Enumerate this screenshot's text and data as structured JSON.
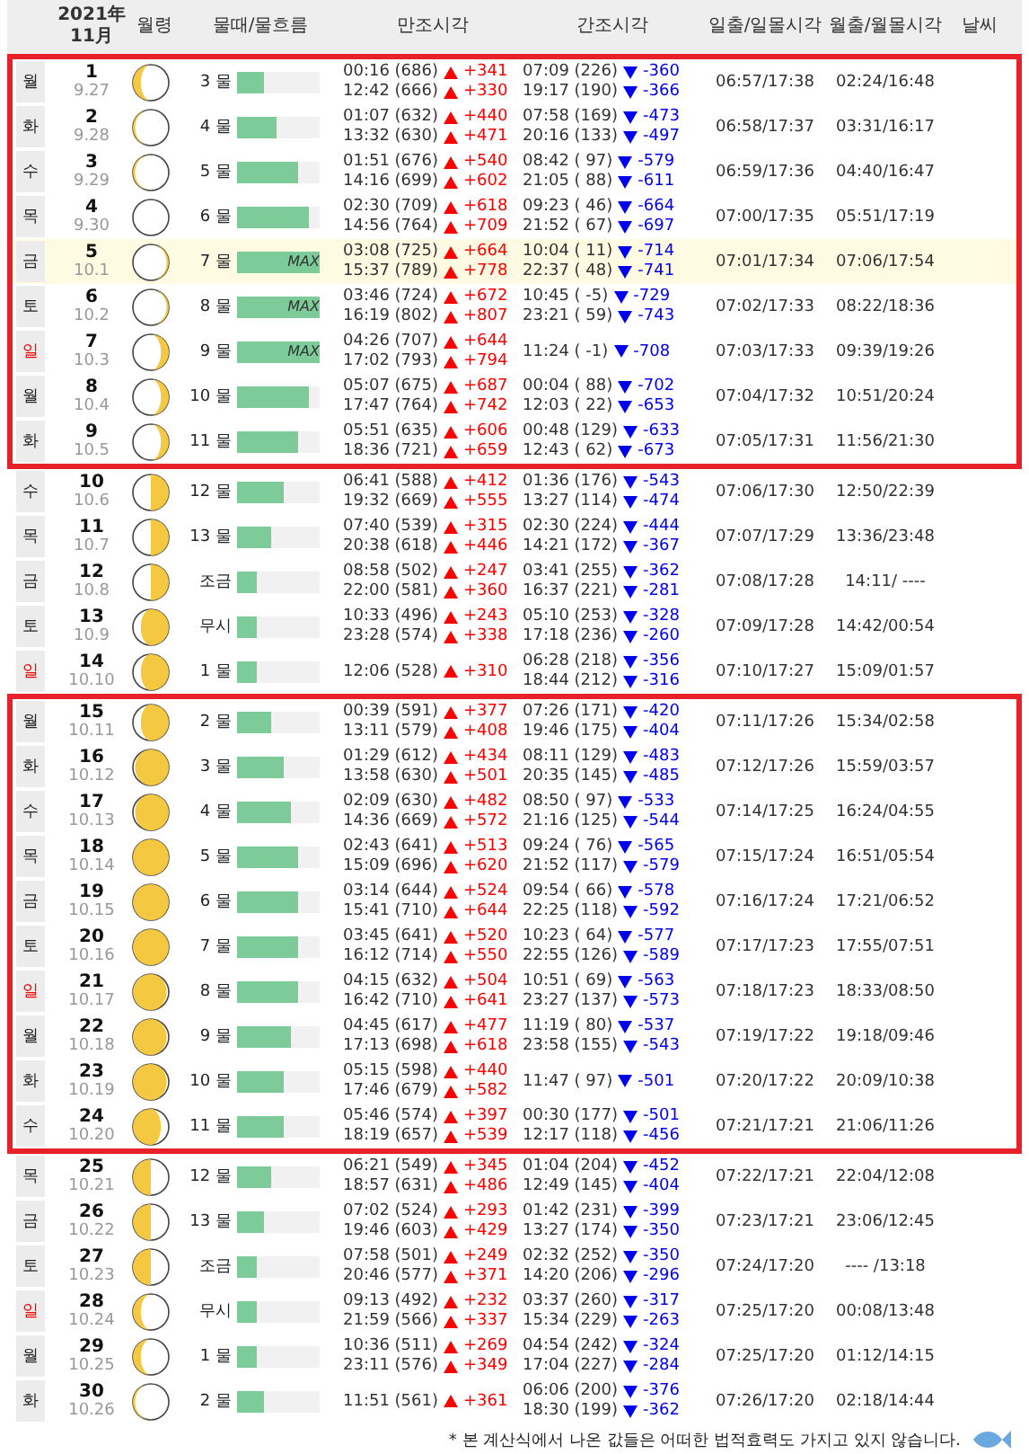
{
  "header": {
    "year": "2021年",
    "month": "11月",
    "columns": [
      "월령",
      "물때/물흐름",
      "만조시각",
      "간조시각",
      "일출/일몰시각",
      "월출/월몰시각",
      "날씨"
    ]
  },
  "groups": [
    {
      "boxed": true,
      "rows": [
        {
          "weekday": "월",
          "holiday": false,
          "highlighted": false,
          "day": "1",
          "lunar": "9.27",
          "moon": {
            "kind": "waning-crescent"
          },
          "tide": "3 물",
          "bar": {
            "level": 0.33
          },
          "high": [
            {
              "time": "00:16 (686)",
              "change": "+341"
            },
            {
              "time": "12:42 (666)",
              "change": "+330"
            }
          ],
          "low": [
            {
              "time": "07:09 (226)",
              "change": "-360"
            },
            {
              "time": "19:17 (190)",
              "change": "-366"
            }
          ],
          "sun": "06:57/17:38",
          "moonrise": "02:24/16:48"
        },
        {
          "weekday": "화",
          "holiday": false,
          "highlighted": false,
          "day": "2",
          "lunar": "9.28",
          "moon": {
            "kind": "waning-sliver"
          },
          "tide": "4 물",
          "bar": {
            "level": 0.48
          },
          "high": [
            {
              "time": "01:07 (632)",
              "change": "+440"
            },
            {
              "time": "13:32 (630)",
              "change": "+471"
            }
          ],
          "low": [
            {
              "time": "07:58 (169)",
              "change": "-473"
            },
            {
              "time": "20:16 (133)",
              "change": "-497"
            }
          ],
          "sun": "06:58/17:37",
          "moonrise": "03:31/16:17"
        },
        {
          "weekday": "수",
          "holiday": false,
          "highlighted": false,
          "day": "3",
          "lunar": "9.29",
          "moon": {
            "kind": "waning-sliver"
          },
          "tide": "5 물",
          "bar": {
            "level": 0.73
          },
          "high": [
            {
              "time": "01:51 (676)",
              "change": "+540"
            },
            {
              "time": "14:16 (699)",
              "change": "+602"
            }
          ],
          "low": [
            {
              "time": "08:42 ( 97)",
              "change": "-579"
            },
            {
              "time": "21:05 ( 88)",
              "change": "-611"
            }
          ],
          "sun": "06:59/17:36",
          "moonrise": "04:40/16:47"
        },
        {
          "weekday": "목",
          "holiday": false,
          "highlighted": false,
          "day": "4",
          "lunar": "9.30",
          "moon": {
            "kind": "new"
          },
          "tide": "6 물",
          "bar": {
            "level": 0.88
          },
          "high": [
            {
              "time": "02:30 (709)",
              "change": "+618"
            },
            {
              "time": "14:56 (764)",
              "change": "+709"
            }
          ],
          "low": [
            {
              "time": "09:23 ( 46)",
              "change": "-664"
            },
            {
              "time": "21:52 ( 67)",
              "change": "-697"
            }
          ],
          "sun": "07:00/17:35",
          "moonrise": "05:51/17:19"
        },
        {
          "weekday": "금",
          "holiday": false,
          "highlighted": true,
          "day": "5",
          "lunar": "10.1",
          "moon": {
            "kind": "waxing-sliver"
          },
          "tide": "7 물",
          "bar": {
            "level": 1,
            "label": "MAX"
          },
          "high": [
            {
              "time": "03:08 (725)",
              "change": "+664"
            },
            {
              "time": "15:37 (789)",
              "change": "+778"
            }
          ],
          "low": [
            {
              "time": "10:04 ( 11)",
              "change": "-714"
            },
            {
              "time": "22:37 ( 48)",
              "change": "-741"
            }
          ],
          "sun": "07:01/17:34",
          "moonrise": "07:06/17:54"
        },
        {
          "weekday": "토",
          "holiday": false,
          "highlighted": false,
          "day": "6",
          "lunar": "10.2",
          "moon": {
            "kind": "waxing-sliver"
          },
          "tide": "8 물",
          "bar": {
            "level": 1,
            "label": "MAX"
          },
          "high": [
            {
              "time": "03:46 (724)",
              "change": "+672"
            },
            {
              "time": "16:19 (802)",
              "change": "+807"
            }
          ],
          "low": [
            {
              "time": "10:45 ( -5)",
              "change": "-729"
            },
            {
              "time": "23:21 ( 59)",
              "change": "-743"
            }
          ],
          "sun": "07:02/17:33",
          "moonrise": "08:22/18:36"
        },
        {
          "weekday": "일",
          "holiday": true,
          "highlighted": false,
          "day": "7",
          "lunar": "10.3",
          "moon": {
            "kind": "waxing-crescent"
          },
          "tide": "9 물",
          "bar": {
            "level": 1,
            "label": "MAX"
          },
          "high": [
            {
              "time": "04:26 (707)",
              "change": "+644"
            },
            {
              "time": "17:02 (793)",
              "change": "+794"
            }
          ],
          "low": [
            {
              "time": "11:24 ( -1)",
              "change": "-708"
            }
          ],
          "sun": "07:03/17:33",
          "moonrise": "09:39/19:26"
        },
        {
          "weekday": "월",
          "holiday": false,
          "highlighted": false,
          "day": "8",
          "lunar": "10.4",
          "moon": {
            "kind": "waxing-crescent"
          },
          "tide": "10 물",
          "bar": {
            "level": 0.88
          },
          "high": [
            {
              "time": "05:07 (675)",
              "change": "+687"
            },
            {
              "time": "17:47 (764)",
              "change": "+742"
            }
          ],
          "low": [
            {
              "time": "00:04 ( 88)",
              "change": "-702"
            },
            {
              "time": "12:03 ( 22)",
              "change": "-653"
            }
          ],
          "sun": "07:04/17:32",
          "moonrise": "10:51/20:24"
        },
        {
          "weekday": "화",
          "holiday": false,
          "highlighted": false,
          "day": "9",
          "lunar": "10.5",
          "moon": {
            "kind": "waxing-crescent"
          },
          "tide": "11 물",
          "bar": {
            "level": 0.73
          },
          "high": [
            {
              "time": "05:51 (635)",
              "change": "+606"
            },
            {
              "time": "18:36 (721)",
              "change": "+659"
            }
          ],
          "low": [
            {
              "time": "00:48 (129)",
              "change": "-633"
            },
            {
              "time": "12:43 ( 62)",
              "change": "-673"
            }
          ],
          "sun": "07:05/17:31",
          "moonrise": "11:56/21:30"
        }
      ]
    },
    {
      "boxed": false,
      "rows": [
        {
          "weekday": "수",
          "holiday": false,
          "highlighted": false,
          "day": "10",
          "lunar": "10.6",
          "moon": {
            "kind": "first-quarter"
          },
          "tide": "12 물",
          "bar": {
            "level": 0.57
          },
          "high": [
            {
              "time": "06:41 (588)",
              "change": "+412"
            },
            {
              "time": "19:32 (669)",
              "change": "+555"
            }
          ],
          "low": [
            {
              "time": "01:36 (176)",
              "change": "-543"
            },
            {
              "time": "13:27 (114)",
              "change": "-474"
            }
          ],
          "sun": "07:06/17:30",
          "moonrise": "12:50/22:39"
        },
        {
          "weekday": "목",
          "holiday": false,
          "highlighted": false,
          "day": "11",
          "lunar": "10.7",
          "moon": {
            "kind": "first-quarter"
          },
          "tide": "13 물",
          "bar": {
            "level": 0.42
          },
          "high": [
            {
              "time": "07:40 (539)",
              "change": "+315"
            },
            {
              "time": "20:38 (618)",
              "change": "+446"
            }
          ],
          "low": [
            {
              "time": "02:30 (224)",
              "change": "-444"
            },
            {
              "time": "14:21 (172)",
              "change": "-367"
            }
          ],
          "sun": "07:07/17:29",
          "moonrise": "13:36/23:48"
        },
        {
          "weekday": "금",
          "holiday": false,
          "highlighted": false,
          "day": "12",
          "lunar": "10.8",
          "moon": {
            "kind": "first-quarter"
          },
          "tide": "조금",
          "bar": {
            "level": 0.24
          },
          "high": [
            {
              "time": "08:58 (502)",
              "change": "+247"
            },
            {
              "time": "22:00 (581)",
              "change": "+360"
            }
          ],
          "low": [
            {
              "time": "03:41 (255)",
              "change": "-362"
            },
            {
              "time": "16:37 (221)",
              "change": "-281"
            }
          ],
          "sun": "07:08/17:28",
          "moonrise": "14:11/ ----"
        },
        {
          "weekday": "토",
          "holiday": false,
          "highlighted": false,
          "day": "13",
          "lunar": "10.9",
          "moon": {
            "kind": "waxing-gibbous"
          },
          "tide": "무시",
          "bar": {
            "level": 0.24
          },
          "high": [
            {
              "time": "10:33 (496)",
              "change": "+243"
            },
            {
              "time": "23:28 (574)",
              "change": "+338"
            }
          ],
          "low": [
            {
              "time": "05:10 (253)",
              "change": "-328"
            },
            {
              "time": "17:18 (236)",
              "change": "-260"
            }
          ],
          "sun": "07:09/17:28",
          "moonrise": "14:42/00:54"
        },
        {
          "weekday": "일",
          "holiday": true,
          "highlighted": false,
          "day": "14",
          "lunar": "10.10",
          "moon": {
            "kind": "waxing-gibbous"
          },
          "tide": "1 물",
          "bar": {
            "level": 0.24
          },
          "high": [
            {
              "time": "12:06 (528)",
              "change": "+310"
            }
          ],
          "low": [
            {
              "time": "06:28 (218)",
              "change": "-356"
            },
            {
              "time": "18:44 (212)",
              "change": "-316"
            }
          ],
          "sun": "07:10/17:27",
          "moonrise": "15:09/01:57"
        }
      ]
    },
    {
      "boxed": true,
      "rows": [
        {
          "weekday": "월",
          "holiday": false,
          "highlighted": false,
          "day": "15",
          "lunar": "10.11",
          "moon": {
            "kind": "waxing-gibbous"
          },
          "tide": "2 물",
          "bar": {
            "level": 0.42
          },
          "high": [
            {
              "time": "00:39 (591)",
              "change": "+377"
            },
            {
              "time": "13:11 (579)",
              "change": "+408"
            }
          ],
          "low": [
            {
              "time": "07:26 (171)",
              "change": "-420"
            },
            {
              "time": "19:46 (175)",
              "change": "-404"
            }
          ],
          "sun": "07:11/17:26",
          "moonrise": "15:34/02:58"
        },
        {
          "weekday": "화",
          "holiday": false,
          "highlighted": false,
          "day": "16",
          "lunar": "10.12",
          "moon": {
            "kind": "waxing-near-full"
          },
          "tide": "3 물",
          "bar": {
            "level": 0.57
          },
          "high": [
            {
              "time": "01:29 (612)",
              "change": "+434"
            },
            {
              "time": "13:58 (630)",
              "change": "+501"
            }
          ],
          "low": [
            {
              "time": "08:11 (129)",
              "change": "-483"
            },
            {
              "time": "20:35 (145)",
              "change": "-485"
            }
          ],
          "sun": "07:12/17:26",
          "moonrise": "15:59/03:57"
        },
        {
          "weekday": "수",
          "holiday": false,
          "highlighted": false,
          "day": "17",
          "lunar": "10.13",
          "moon": {
            "kind": "waxing-near-full"
          },
          "tide": "4 물",
          "bar": {
            "level": 0.66
          },
          "high": [
            {
              "time": "02:09 (630)",
              "change": "+482"
            },
            {
              "time": "14:36 (669)",
              "change": "+572"
            }
          ],
          "low": [
            {
              "time": "08:50 ( 97)",
              "change": "-533"
            },
            {
              "time": "21:16 (125)",
              "change": "-544"
            }
          ],
          "sun": "07:14/17:25",
          "moonrise": "16:24/04:55"
        },
        {
          "weekday": "목",
          "holiday": false,
          "highlighted": false,
          "day": "18",
          "lunar": "10.14",
          "moon": {
            "kind": "full"
          },
          "tide": "5 물",
          "bar": {
            "level": 0.73
          },
          "high": [
            {
              "time": "02:43 (641)",
              "change": "+513"
            },
            {
              "time": "15:09 (696)",
              "change": "+620"
            }
          ],
          "low": [
            {
              "time": "09:24 ( 76)",
              "change": "-565"
            },
            {
              "time": "21:52 (117)",
              "change": "-579"
            }
          ],
          "sun": "07:15/17:24",
          "moonrise": "16:51/05:54"
        },
        {
          "weekday": "금",
          "holiday": false,
          "highlighted": false,
          "day": "19",
          "lunar": "10.15",
          "moon": {
            "kind": "full"
          },
          "tide": "6 물",
          "bar": {
            "level": 0.73
          },
          "high": [
            {
              "time": "03:14 (644)",
              "change": "+524"
            },
            {
              "time": "15:41 (710)",
              "change": "+644"
            }
          ],
          "low": [
            {
              "time": "09:54 ( 66)",
              "change": "-578"
            },
            {
              "time": "22:25 (118)",
              "change": "-592"
            }
          ],
          "sun": "07:16/17:24",
          "moonrise": "17:21/06:52"
        },
        {
          "weekday": "토",
          "holiday": false,
          "highlighted": false,
          "day": "20",
          "lunar": "10.16",
          "moon": {
            "kind": "full"
          },
          "tide": "7 물",
          "bar": {
            "level": 0.73
          },
          "high": [
            {
              "time": "03:45 (641)",
              "change": "+520"
            },
            {
              "time": "16:12 (714)",
              "change": "+550"
            }
          ],
          "low": [
            {
              "time": "10:23 ( 64)",
              "change": "-577"
            },
            {
              "time": "22:55 (126)",
              "change": "-589"
            }
          ],
          "sun": "07:17/17:23",
          "moonrise": "17:55/07:51"
        },
        {
          "weekday": "일",
          "holiday": true,
          "highlighted": false,
          "day": "21",
          "lunar": "10.17",
          "moon": {
            "kind": "waning-near-full"
          },
          "tide": "8 물",
          "bar": {
            "level": 0.73
          },
          "high": [
            {
              "time": "04:15 (632)",
              "change": "+504"
            },
            {
              "time": "16:42 (710)",
              "change": "+641"
            }
          ],
          "low": [
            {
              "time": "10:51 ( 69)",
              "change": "-563"
            },
            {
              "time": "23:27 (137)",
              "change": "-573"
            }
          ],
          "sun": "07:18/17:23",
          "moonrise": "18:33/08:50"
        },
        {
          "weekday": "월",
          "holiday": false,
          "highlighted": false,
          "day": "22",
          "lunar": "10.18",
          "moon": {
            "kind": "waning-near-full"
          },
          "tide": "9 물",
          "bar": {
            "level": 0.66
          },
          "high": [
            {
              "time": "04:45 (617)",
              "change": "+477"
            },
            {
              "time": "17:13 (698)",
              "change": "+618"
            }
          ],
          "low": [
            {
              "time": "11:19 ( 80)",
              "change": "-537"
            },
            {
              "time": "23:58 (155)",
              "change": "-543"
            }
          ],
          "sun": "07:19/17:22",
          "moonrise": "19:18/09:46"
        },
        {
          "weekday": "화",
          "holiday": false,
          "highlighted": false,
          "day": "23",
          "lunar": "10.19",
          "moon": {
            "kind": "waning-near-full"
          },
          "tide": "10 물",
          "bar": {
            "level": 0.57
          },
          "high": [
            {
              "time": "05:15 (598)",
              "change": "+440"
            },
            {
              "time": "17:46 (679)",
              "change": "+582"
            }
          ],
          "low": [
            {
              "time": "11:47 ( 97)",
              "change": "-501"
            }
          ],
          "sun": "07:20/17:22",
          "moonrise": "20:09/10:38"
        },
        {
          "weekday": "수",
          "holiday": false,
          "highlighted": false,
          "day": "24",
          "lunar": "10.20",
          "moon": {
            "kind": "waning-gibbous"
          },
          "tide": "11 물",
          "bar": {
            "level": 0.57
          },
          "high": [
            {
              "time": "05:46 (574)",
              "change": "+397"
            },
            {
              "time": "18:19 (657)",
              "change": "+539"
            }
          ],
          "low": [
            {
              "time": "00:30 (177)",
              "change": "-501"
            },
            {
              "time": "12:17 (118)",
              "change": "-456"
            }
          ],
          "sun": "07:21/17:21",
          "moonrise": "21:06/11:26"
        }
      ]
    },
    {
      "boxed": false,
      "rows": [
        {
          "weekday": "목",
          "holiday": false,
          "highlighted": false,
          "day": "25",
          "lunar": "10.21",
          "moon": {
            "kind": "last-quarter"
          },
          "tide": "12 물",
          "bar": {
            "level": 0.42
          },
          "high": [
            {
              "time": "06:21 (549)",
              "change": "+345"
            },
            {
              "time": "18:57 (631)",
              "change": "+486"
            }
          ],
          "low": [
            {
              "time": "01:04 (204)",
              "change": "-452"
            },
            {
              "time": "12:49 (145)",
              "change": "-404"
            }
          ],
          "sun": "07:22/17:21",
          "moonrise": "22:04/12:08"
        },
        {
          "weekday": "금",
          "holiday": false,
          "highlighted": false,
          "day": "26",
          "lunar": "10.22",
          "moon": {
            "kind": "last-quarter"
          },
          "tide": "13 물",
          "bar": {
            "level": 0.33
          },
          "high": [
            {
              "time": "07:02 (524)",
              "change": "+293"
            },
            {
              "time": "19:46 (603)",
              "change": "+429"
            }
          ],
          "low": [
            {
              "time": "01:42 (231)",
              "change": "-399"
            },
            {
              "time": "13:27 (174)",
              "change": "-350"
            }
          ],
          "sun": "07:23/17:21",
          "moonrise": "23:06/12:45"
        },
        {
          "weekday": "토",
          "holiday": false,
          "highlighted": false,
          "day": "27",
          "lunar": "10.23",
          "moon": {
            "kind": "last-quarter"
          },
          "tide": "조금",
          "bar": {
            "level": 0.24
          },
          "high": [
            {
              "time": "07:58 (501)",
              "change": "+249"
            },
            {
              "time": "20:46 (577)",
              "change": "+371"
            }
          ],
          "low": [
            {
              "time": "02:32 (252)",
              "change": "-350"
            },
            {
              "time": "14:20 (206)",
              "change": "-296"
            }
          ],
          "sun": "07:24/17:20",
          "moonrise": "---- /13:18"
        },
        {
          "weekday": "일",
          "holiday": true,
          "highlighted": false,
          "day": "28",
          "lunar": "10.24",
          "moon": {
            "kind": "waning-crescent"
          },
          "tide": "무시",
          "bar": {
            "level": 0.24
          },
          "high": [
            {
              "time": "09:13 (492)",
              "change": "+232"
            },
            {
              "time": "21:59 (566)",
              "change": "+337"
            }
          ],
          "low": [
            {
              "time": "03:37 (260)",
              "change": "-317"
            },
            {
              "time": "15:34 (229)",
              "change": "-263"
            }
          ],
          "sun": "07:25/17:20",
          "moonrise": "00:08/13:48"
        },
        {
          "weekday": "월",
          "holiday": false,
          "highlighted": false,
          "day": "29",
          "lunar": "10.25",
          "moon": {
            "kind": "waning-crescent"
          },
          "tide": "1 물",
          "bar": {
            "level": 0.24
          },
          "high": [
            {
              "time": "10:36 (511)",
              "change": "+269"
            },
            {
              "time": "23:11 (576)",
              "change": "+349"
            }
          ],
          "low": [
            {
              "time": "04:54 (242)",
              "change": "-324"
            },
            {
              "time": "17:04 (227)",
              "change": "-284"
            }
          ],
          "sun": "07:25/17:20",
          "moonrise": "01:12/14:15"
        },
        {
          "weekday": "화",
          "holiday": false,
          "highlighted": false,
          "day": "30",
          "lunar": "10.26",
          "moon": {
            "kind": "waning-sliver"
          },
          "tide": "2 물",
          "bar": {
            "level": 0.33
          },
          "high": [
            {
              "time": "11:51 (561)",
              "change": "+361"
            }
          ],
          "low": [
            {
              "time": "06:06 (200)",
              "change": "-376"
            },
            {
              "time": "18:30 (199)",
              "change": "-362"
            }
          ],
          "sun": "07:26/17:20",
          "moonrise": "02:18/14:44"
        }
      ]
    }
  ],
  "footnote": "* 본 계산식에서 나온 값들은 어떠한 법적효력도 가지고 있지 않습니다."
}
